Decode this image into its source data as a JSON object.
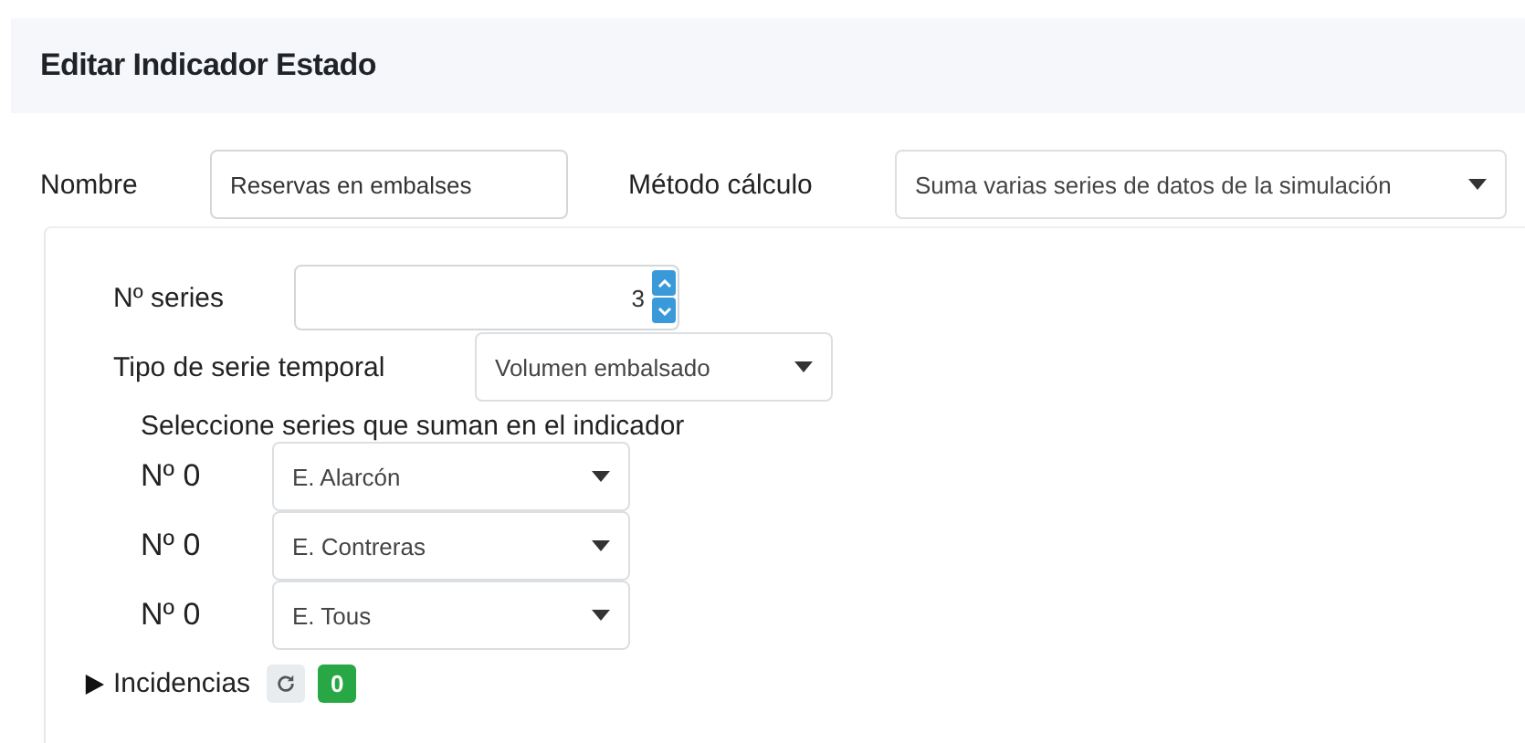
{
  "header": {
    "title": "Editar Indicador Estado"
  },
  "name_field": {
    "label": "Nombre",
    "value": "Reservas en embalses"
  },
  "method_field": {
    "label": "Método cálculo",
    "value": "Suma varias series de datos de la simulación"
  },
  "series_count": {
    "label": "Nº series",
    "value": "3"
  },
  "series_type": {
    "label": "Tipo de serie temporal",
    "value": "Volumen embalsado"
  },
  "selection": {
    "label": "Seleccione series que suman en el indicador",
    "rows": [
      {
        "label": "Nº 0",
        "value": "E. Alarcón"
      },
      {
        "label": "Nº 0",
        "value": "E. Contreras"
      },
      {
        "label": "Nº 0",
        "value": "E. Tous"
      }
    ]
  },
  "incidents": {
    "label": "Incidencias",
    "expanded": false,
    "count": "0"
  }
}
